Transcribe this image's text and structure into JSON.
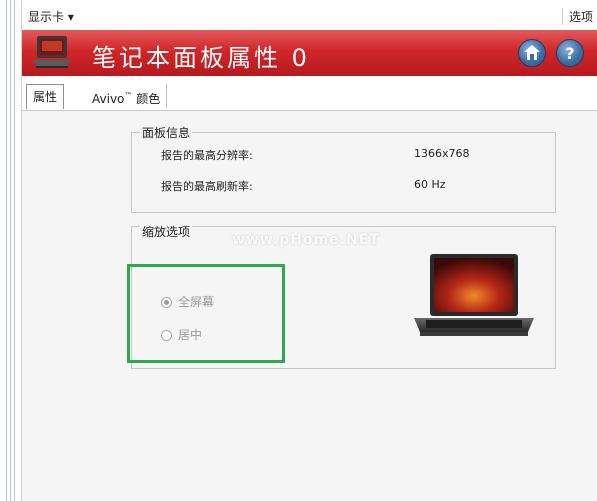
{
  "menubar": {
    "display_card_label": "显示卡 ▾",
    "options_label": "选项"
  },
  "banner": {
    "title": "笔记本面板属性 0",
    "home_icon": "home-icon",
    "help_icon": "help-icon"
  },
  "tabs": [
    {
      "label": "属性"
    },
    {
      "label": "Avivo",
      "sup": "™",
      "suffix": " 颜色"
    }
  ],
  "panel_info": {
    "title": "面板信息",
    "rows": [
      {
        "label": "报告的最高分辨率:",
        "value": "1366x768"
      },
      {
        "label": "报告的最高刷新率:",
        "value": "60 Hz"
      }
    ]
  },
  "scaling": {
    "title": "缩放选项",
    "options": [
      {
        "label": "全屏幕",
        "selected": true
      },
      {
        "label": "居中",
        "selected": false
      }
    ]
  },
  "watermark": "www.pHome.NET",
  "colors": {
    "banner_red": "#d0262a",
    "highlight_green": "#2fa84f",
    "panel_bg": "#f5f5f5"
  }
}
